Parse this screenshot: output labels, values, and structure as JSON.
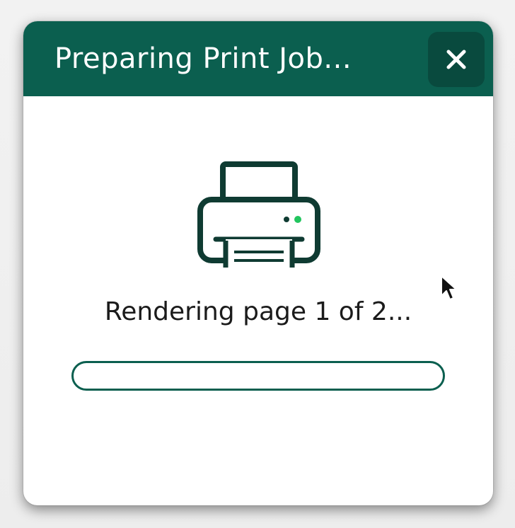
{
  "dialog": {
    "title": "Preparing Print Job...",
    "close_icon": "close-icon",
    "printer_icon": "printer-icon",
    "status_text": "Rendering page 1 of 2...",
    "progress": 0
  },
  "colors": {
    "accent": "#0b5f4f",
    "close_button_bg": "#094a3e",
    "printer_stroke": "#0f3b32",
    "status_led": "#22c55e"
  },
  "cursor_icon": "mouse-pointer-icon"
}
